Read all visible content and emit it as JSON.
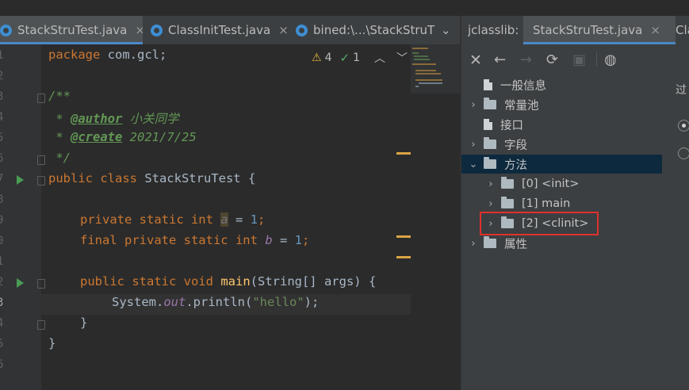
{
  "editor_tabs": [
    {
      "label": "StackStruTest.java",
      "active": true
    },
    {
      "label": "ClassInitTest.java",
      "active": false
    },
    {
      "label": "bined:\\...\\StackStruT",
      "active": false
    }
  ],
  "close_glyph": "×",
  "right_tabs": {
    "panel_title": "jclasslib:",
    "items": [
      {
        "label": "StackStruTest.java",
        "active": true
      },
      {
        "label": "Cla",
        "active": false
      }
    ]
  },
  "inspections": {
    "warnings": "4",
    "typos": "1"
  },
  "line_numbers": [
    "1",
    "2",
    "3",
    "4",
    "5",
    "6",
    "7",
    "8",
    "9",
    "0",
    "1",
    "2",
    "3",
    "4",
    "5",
    "6"
  ],
  "code": {
    "l1_kw": "package",
    "l1_rest": " com.gcl;",
    "l3": "/**",
    "l4_star": " * ",
    "l4_tag": "@author",
    "l4_val": " 小关同学",
    "l5_star": " * ",
    "l5_tag": "@create",
    "l5_val": " 2021/7/25",
    "l6": " */",
    "l7_kw": "public class",
    "l7_rest": " StackStruTest {",
    "l9_kw": "private static int",
    "l9_var": "a",
    "l9_eq": " = ",
    "l9_num": "1",
    "l9_semi": ";",
    "l10_kw": "final private static int",
    "l10_var": "b",
    "l10_eq": " = ",
    "l10_num": "1",
    "l10_semi": ";",
    "l12_kw": "public static void",
    "l12_fn": "main",
    "l12_rest": "(String[] args) {",
    "l13_a": "System.",
    "l13_fld": "out",
    "l13_b": ".println(",
    "l13_str": "\"hello\"",
    "l13_c": ");",
    "l14": "}",
    "l15": "}"
  },
  "tree": {
    "general_info": "一般信息",
    "constant_pool": "常量池",
    "interfaces": "接口",
    "fields": "字段",
    "methods": "方法",
    "method_init": "[0] <init>",
    "method_main": "[1] main",
    "method_clinit": "[2] <clinit>",
    "attributes": "属性"
  },
  "right_edge_label": "过",
  "colors": {
    "accent": "#4a88c7",
    "highlight_box": "#e0302c",
    "selection": "#0d293e"
  }
}
